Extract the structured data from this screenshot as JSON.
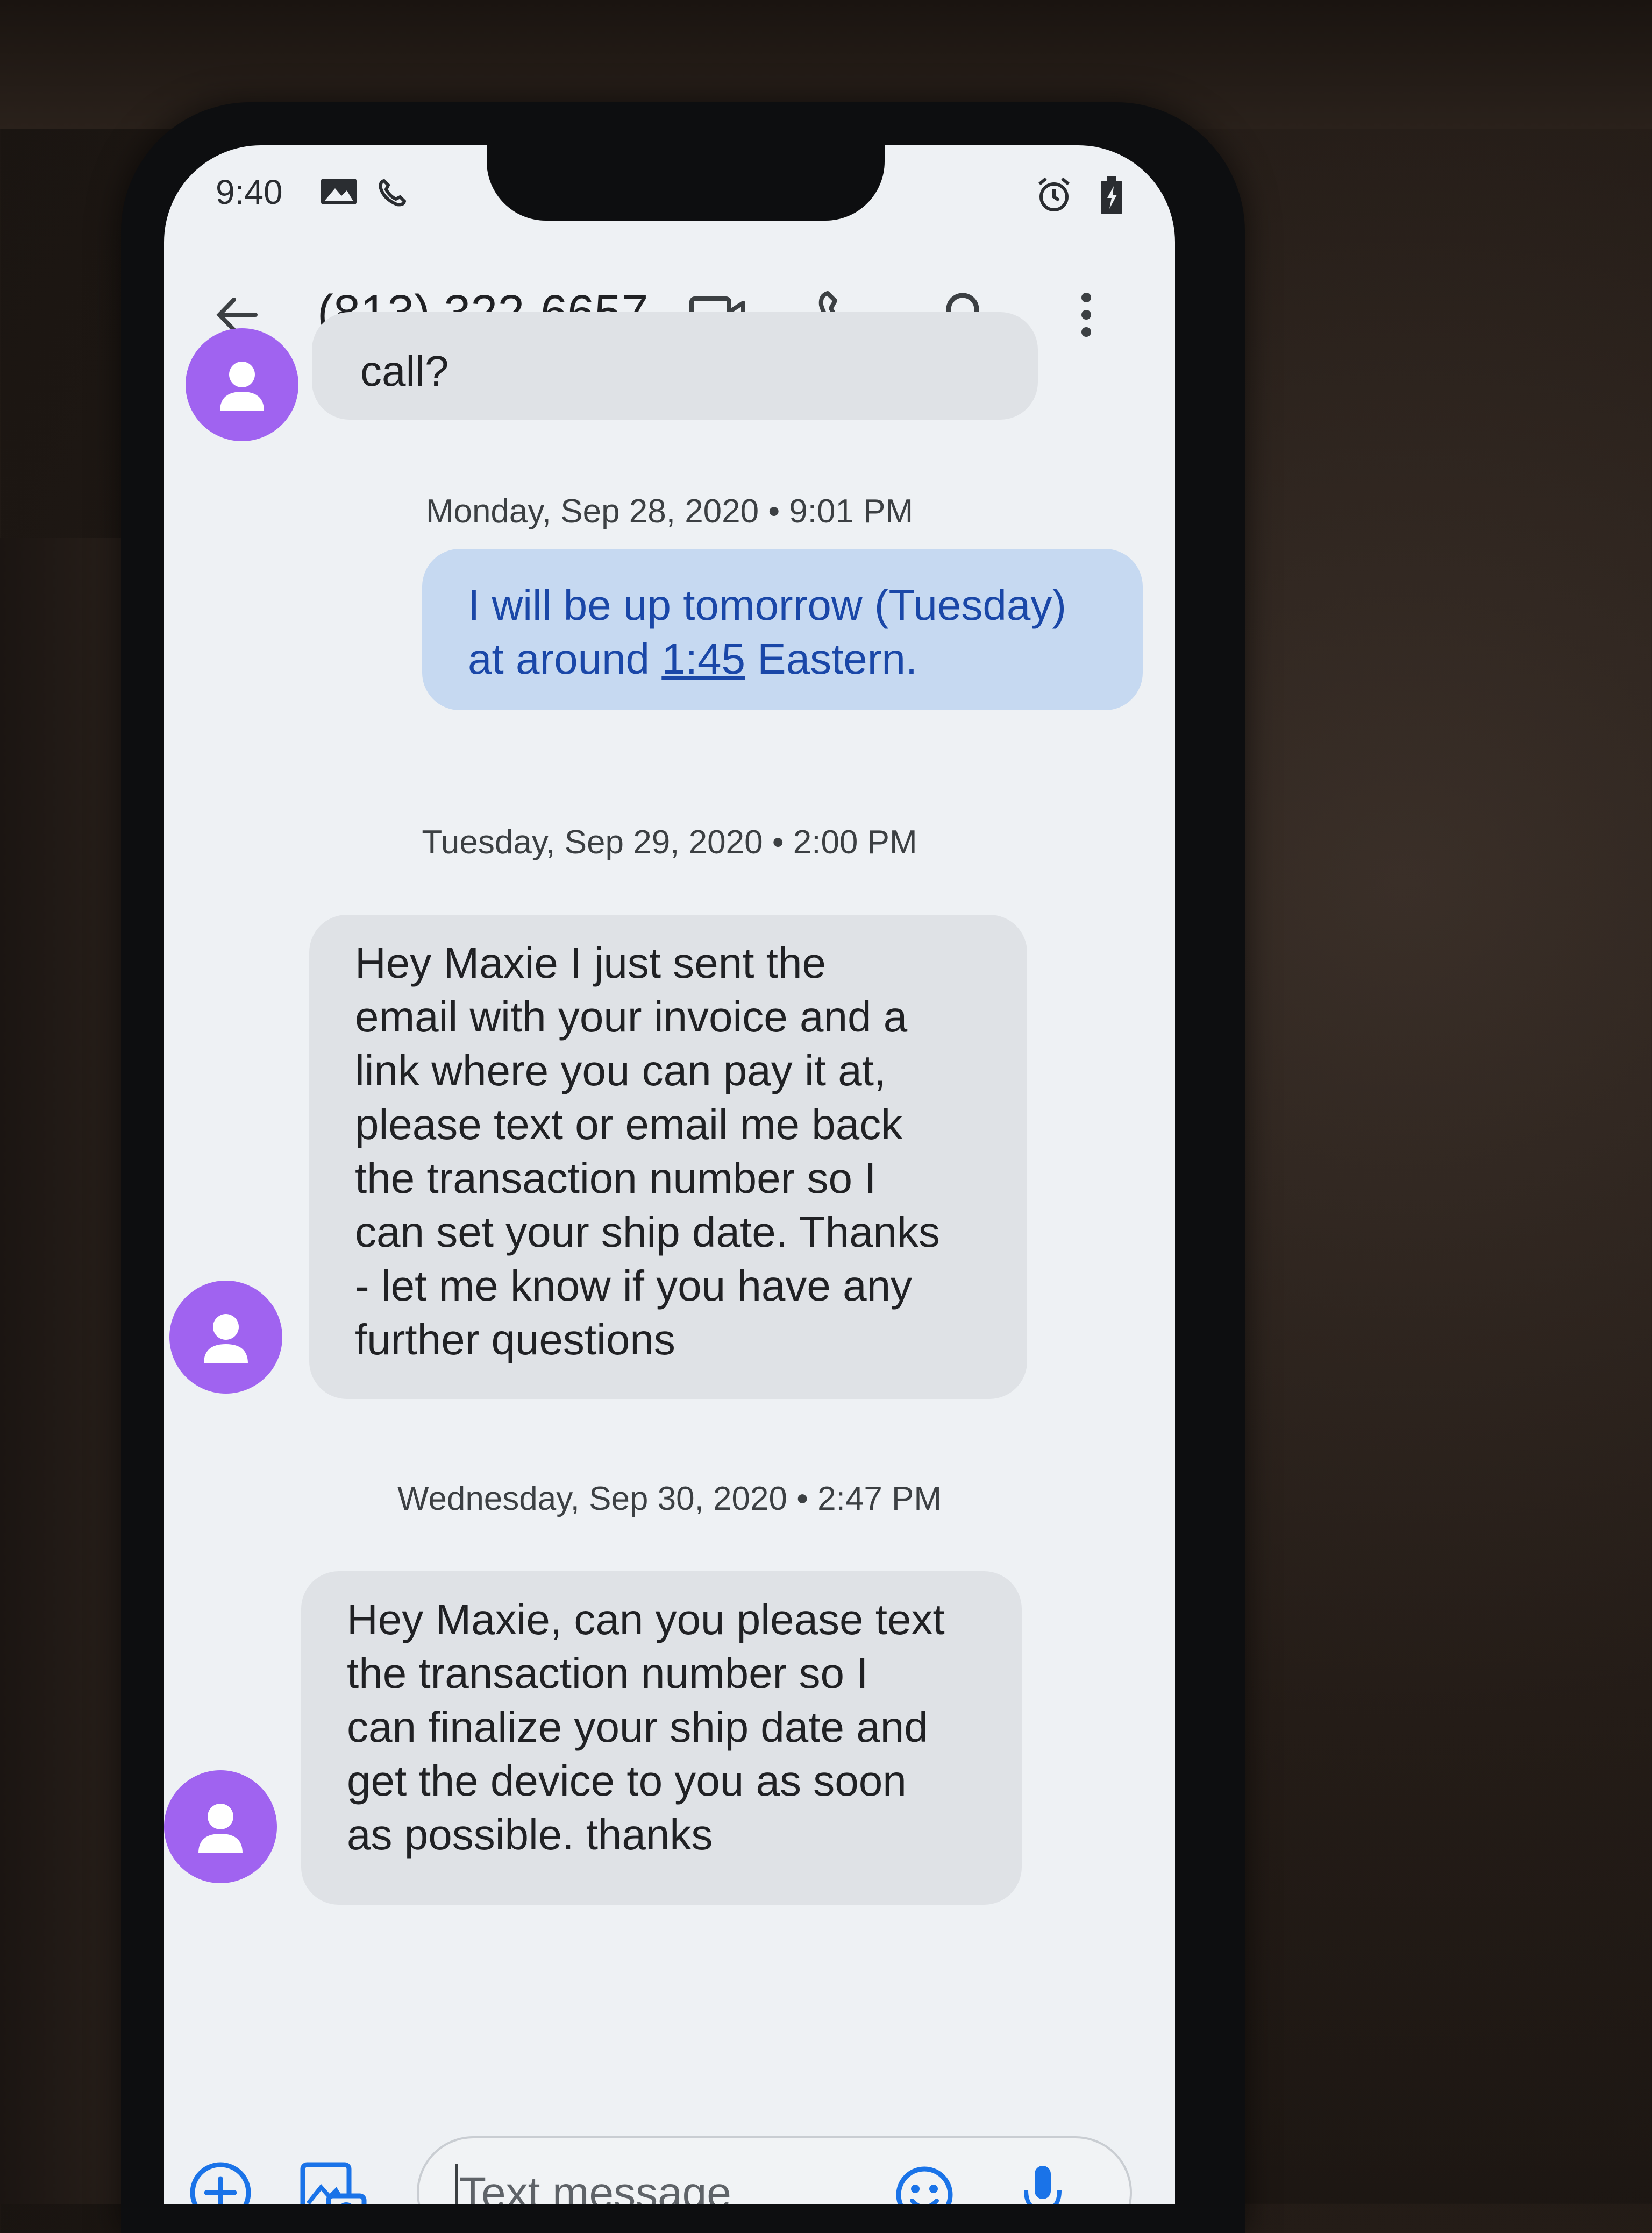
{
  "status_bar": {
    "time": "9:40",
    "icons": [
      "gallery-icon",
      "wifi-calling-icon",
      "alarm-icon",
      "battery-charging-icon"
    ]
  },
  "app_bar": {
    "back_icon": "arrow-back-icon",
    "title": "(813) 322-6657",
    "actions": [
      "video-call-icon",
      "phone-icon",
      "search-icon",
      "more-vert-icon"
    ]
  },
  "messages": {
    "partial_top": "call?",
    "sep1": "Monday, Sep 28, 2020 • 9:01 PM",
    "out1_line1": "I will be up tomorrow (Tuesday)",
    "out1_line2_pre": "at around ",
    "out1_link": "1:45",
    "out1_line2_post": " Eastern.",
    "sep2": "Tuesday, Sep 29, 2020 • 2:00 PM",
    "in1": [
      "Hey Maxie I just sent the",
      "email with your invoice and a",
      "link where you can pay it at,",
      "please text or email me back",
      "the transaction number so I",
      "can set your ship date. Thanks",
      "- let me know if you have any",
      "further questions"
    ],
    "sep3": "Wednesday, Sep 30, 2020 • 2:47 PM",
    "in2": [
      "Hey Maxie, can you please text",
      "the transaction number so I",
      "can finalize your ship date and",
      "get the device to you as soon",
      "as possible. thanks"
    ]
  },
  "compose": {
    "placeholder": "Text message",
    "left_icons": [
      "add-circle-icon",
      "gallery-camera-icon"
    ],
    "right_icons": [
      "emoji-icon",
      "microphone-icon"
    ]
  },
  "colors": {
    "accent_blue": "#1a73e8",
    "avatar_purple": "#a063f0",
    "outgoing_bubble": "#c6d9f1",
    "incoming_bubble": "#dfe2e6"
  }
}
